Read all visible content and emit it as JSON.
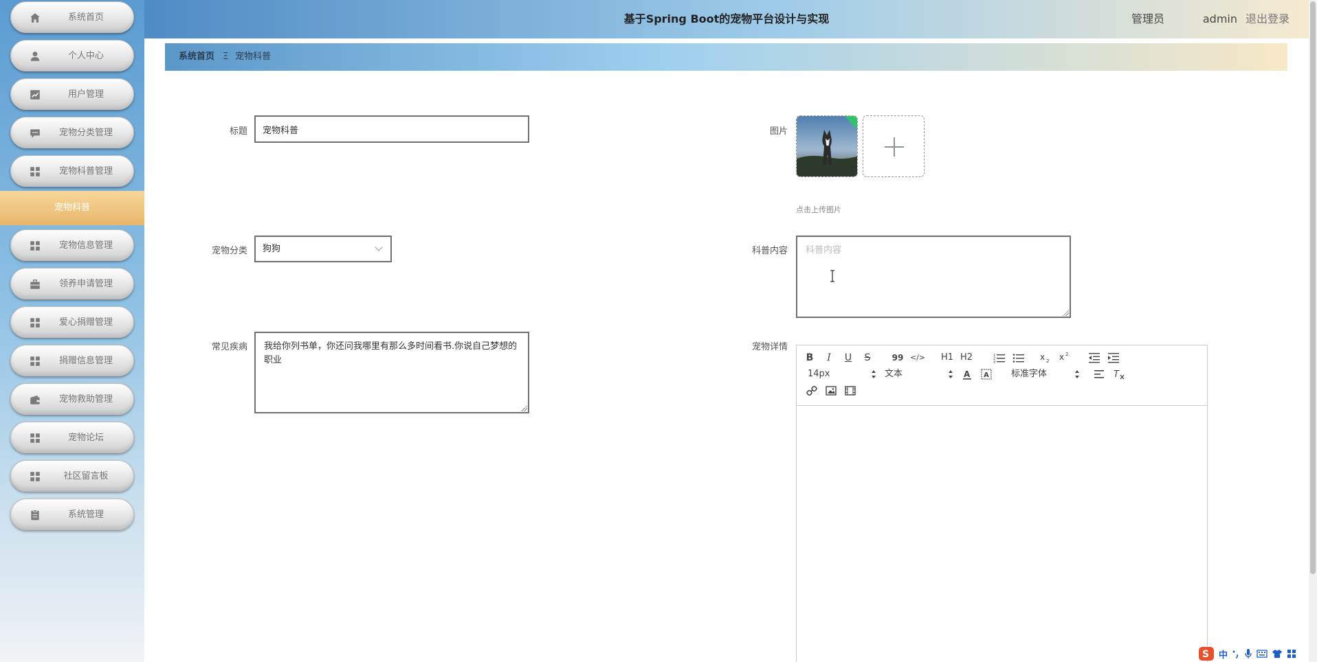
{
  "header": {
    "title": "基于Spring Boot的宠物平台设计与实现",
    "user_role": "管理员",
    "user_name": "admin",
    "logout": "退出登录"
  },
  "sidebar": {
    "items": [
      {
        "label": "系统首页",
        "icon": "home-icon"
      },
      {
        "label": "个人中心",
        "icon": "user-icon"
      },
      {
        "label": "用户管理",
        "icon": "chart-icon"
      },
      {
        "label": "宠物分类管理",
        "icon": "comment-icon"
      },
      {
        "label": "宠物科普管理",
        "icon": "grid-icon"
      },
      {
        "label": "宠物信息管理",
        "icon": "grid-icon"
      },
      {
        "label": "领养申请管理",
        "icon": "briefcase-icon"
      },
      {
        "label": "爱心捐赠管理",
        "icon": "grid-icon"
      },
      {
        "label": "捐赠信息管理",
        "icon": "grid-icon"
      },
      {
        "label": "宠物救助管理",
        "icon": "wallet-icon"
      },
      {
        "label": "宠物论坛",
        "icon": "grid-icon"
      },
      {
        "label": "社区留言板",
        "icon": "grid-icon"
      },
      {
        "label": "系统管理",
        "icon": "clipboard-icon"
      }
    ],
    "active_sub": "宠物科普"
  },
  "breadcrumb": {
    "home": "系统首页",
    "separator": "Ξ",
    "current": "宠物科普"
  },
  "form": {
    "title_label": "标题",
    "title_value": "宠物科普",
    "category_label": "宠物分类",
    "category_value": "狗狗",
    "disease_label": "常见疾病",
    "disease_value": "我给你列书单，你还问我哪里有那么多时间看书.你说自己梦想的职业",
    "image_label": "图片",
    "upload_tip": "点击上传图片",
    "content_label": "科普内容",
    "content_placeholder": "科普内容",
    "detail_label": "宠物详情"
  },
  "editor": {
    "font_size": "14px",
    "text_style": "文本",
    "font_family": "标准字体",
    "buttons": [
      "B",
      "I",
      "U",
      "S",
      "99",
      "</>",
      "H1",
      "H2"
    ]
  },
  "ime": {
    "mode": "中"
  },
  "colors": {
    "active_sub": "#e9b66a",
    "header_start": "#4f8bc4",
    "header_end": "#f6ead0"
  }
}
